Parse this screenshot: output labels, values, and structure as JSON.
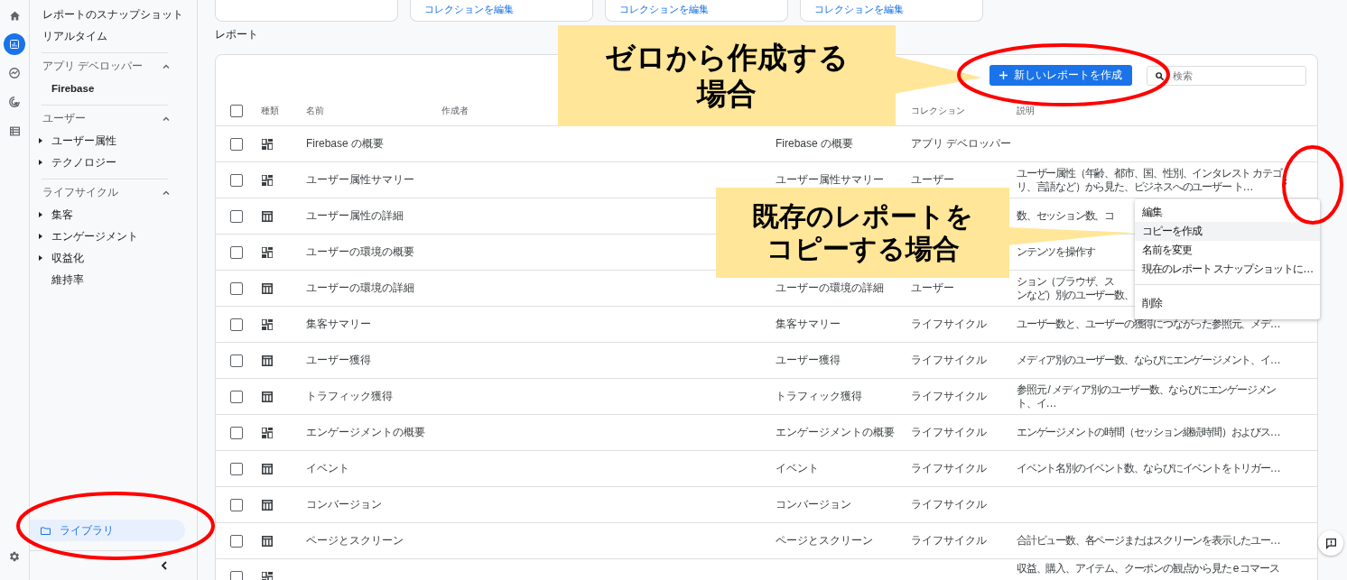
{
  "rail": [
    {
      "kind": "home",
      "selected": false
    },
    {
      "kind": "reports",
      "selected": true
    },
    {
      "kind": "explore",
      "selected": false
    },
    {
      "kind": "advertising",
      "selected": false
    },
    {
      "kind": "configure",
      "selected": false
    }
  ],
  "sidebar": {
    "top_items": [
      "レポートのスナップショット",
      "リアルタイム"
    ],
    "sections": [
      {
        "title": "アプリ デベロッパー",
        "expanded": true,
        "items": [
          {
            "label": "Firebase",
            "expandable": false
          }
        ]
      },
      {
        "title": "ユーザー",
        "expanded": true,
        "items": [
          {
            "label": "ユーザー属性",
            "expandable": true
          },
          {
            "label": "テクノロジー",
            "expandable": true
          }
        ]
      },
      {
        "title": "ライフサイクル",
        "expanded": true,
        "items": [
          {
            "label": "集客",
            "expandable": true
          },
          {
            "label": "エンゲージメント",
            "expandable": true
          },
          {
            "label": "収益化",
            "expandable": true
          },
          {
            "label": "維持率",
            "expandable": false
          }
        ]
      }
    ],
    "library": {
      "label": "ライブラリ",
      "selected": true
    }
  },
  "collection_cards": [
    {
      "kind": "blank"
    },
    {
      "kind": "link",
      "edit_link": "コレクションを編集"
    },
    {
      "kind": "link",
      "edit_link": "コレクションを編集"
    },
    {
      "kind": "link",
      "edit_link": "コレクションを編集"
    }
  ],
  "section_title": "レポート",
  "toolbar": {
    "create_button": "新しいレポートを作成",
    "search": {
      "placeholder": "検索"
    }
  },
  "table": {
    "columns": {
      "kind": "種類",
      "name": "名前",
      "creator": "作成者",
      "collection": "コレクション",
      "description": "説明"
    },
    "header_checked": false,
    "rows": [
      {
        "kind": "overview",
        "checked": false,
        "hovered": false,
        "name": "Firebase の概要",
        "column_4": "Firebase の概要",
        "collection": "アプリ デベロッパー"
      },
      {
        "kind": "overview",
        "checked": false,
        "hovered": true,
        "name": "ユーザー属性サマリー",
        "column_4": "ユーザー属性サマリー",
        "collection": "ユーザー",
        "description": [
          "ユーザー属性（年齢、都市、国、性別、インタレスト カテゴ",
          "リ、言語など）から見た、ビジネスへのユーザー ト…"
        ]
      },
      {
        "kind": "detail",
        "checked": false,
        "hovered": false,
        "name": "ユーザー属性の詳細",
        "description": [
          "数、セッション数、コ"
        ]
      },
      {
        "kind": "overview",
        "checked": false,
        "hovered": false,
        "name": "ユーザーの環境の概要",
        "description": [
          "ンテンツを操作す"
        ]
      },
      {
        "kind": "detail",
        "checked": false,
        "hovered": false,
        "name": "ユーザーの環境の詳細",
        "column_4": "ユーザーの環境の詳細",
        "collection": "ユーザー",
        "description": [
          "ション（ブラウザ、ス",
          "ンなど）別のユーザー数、"
        ]
      },
      {
        "kind": "overview",
        "checked": false,
        "hovered": false,
        "name": "集客サマリー",
        "column_4": "集客サマリー",
        "collection": "ライフサイクル",
        "description": [
          "ユーザー数と、ユーザーの獲得につながった参照元、メデ…"
        ]
      },
      {
        "kind": "detail",
        "checked": false,
        "hovered": false,
        "name": "ユーザー獲得",
        "column_4": "ユーザー獲得",
        "collection": "ライフサイクル",
        "description": [
          "メディア別のユーザー数、ならびにエンゲージメント、イ…"
        ]
      },
      {
        "kind": "detail",
        "checked": false,
        "hovered": false,
        "name": "トラフィック獲得",
        "column_4": "トラフィック獲得",
        "collection": "ライフサイクル",
        "description": [
          "参照元 / メディア別のユーザー数、ならびにエンゲージメン",
          "ト、イ…"
        ]
      },
      {
        "kind": "overview",
        "checked": false,
        "hovered": false,
        "name": "エンゲージメントの概要",
        "column_4": "エンゲージメントの概要",
        "collection": "ライフサイクル",
        "description": [
          "エンゲージメントの時間（セッション継続時間）およびス…"
        ]
      },
      {
        "kind": "detail",
        "checked": false,
        "hovered": false,
        "name": "イベント",
        "column_4": "イベント",
        "collection": "ライフサイクル",
        "description": [
          "イベント名別のイベント数、ならびにイベントをトリガー…"
        ]
      },
      {
        "kind": "detail",
        "checked": false,
        "hovered": false,
        "name": "コンバージョン",
        "column_4": "コンバージョン",
        "collection": "ライフサイクル"
      },
      {
        "kind": "detail",
        "checked": false,
        "hovered": false,
        "name": "ページとスクリーン",
        "column_4": "ページとスクリーン",
        "collection": "ライフサイクル",
        "description": [
          "合計ビュー数、各ページまたはスクリーンを表示したユー…"
        ]
      },
      {
        "kind": "overview",
        "checked": false,
        "hovered": false,
        "description": [
          "収益、購入、アイテム、クーポンの観点から見た e コマース"
        ]
      }
    ]
  },
  "row_menu": {
    "items": [
      {
        "label": "編集",
        "selected": false
      },
      {
        "label": "コピーを作成",
        "selected": true
      },
      {
        "label": "名前を変更",
        "selected": false
      },
      {
        "label": "現在のレポート スナップショットに…",
        "selected": false
      }
    ],
    "footer_items": [
      {
        "label": "削除",
        "selected": false
      }
    ]
  },
  "annotations": [
    {
      "text": "ゼロから作成する場合"
    },
    {
      "text": "既存のレポートをコピーする場合"
    }
  ]
}
